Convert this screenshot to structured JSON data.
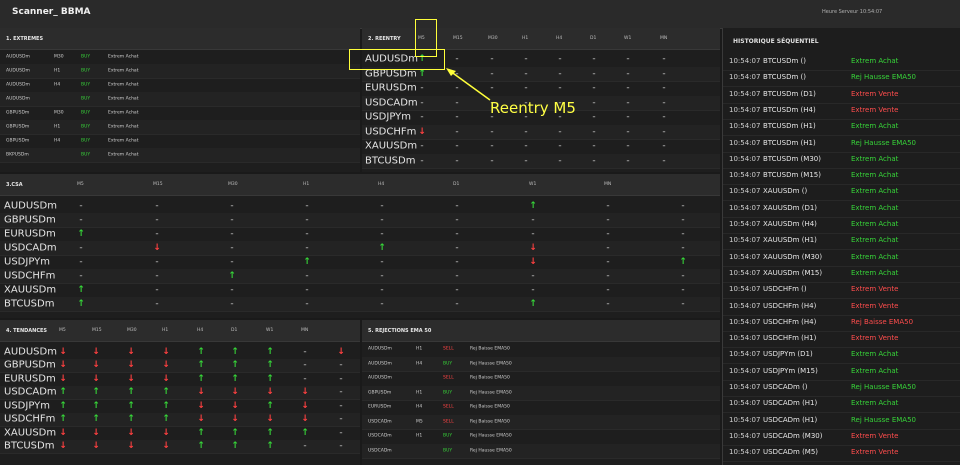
{
  "title": "Scanner_ BBMA",
  "hour": "Heure Serveur 10:54:07",
  "timeframes": [
    "M5",
    "M15",
    "M30",
    "H1",
    "H4",
    "D1",
    "W1",
    "MN"
  ],
  "extremes": {
    "title": "1. EXTREMES",
    "rows": [
      {
        "symbol": "AUDUSDm",
        "tf": "M30",
        "dir": "BUY",
        "label": "Extrem Achat"
      },
      {
        "symbol": "AUDUSDm",
        "tf": "H1",
        "dir": "BUY",
        "label": "Extrem Achat"
      },
      {
        "symbol": "AUDUSDm",
        "tf": "H4",
        "dir": "BUY",
        "label": "Extrem Achat"
      },
      {
        "symbol": "AUDUSDm",
        "tf": "",
        "dir": "BUY",
        "label": "Extrem Achat"
      },
      {
        "symbol": "GBPUSDm",
        "tf": "M30",
        "dir": "BUY",
        "label": "Extrem Achat"
      },
      {
        "symbol": "GBPUSDm",
        "tf": "H1",
        "dir": "BUY",
        "label": "Extrem Achat"
      },
      {
        "symbol": "GBPUSDm",
        "tf": "H4",
        "dir": "BUY",
        "label": "Extrem Achat"
      },
      {
        "symbol": "BKPUSDm",
        "tf": "",
        "dir": "BUY",
        "label": "Extrem Achat"
      }
    ]
  },
  "reentry": {
    "title": "2. REENTRY",
    "rows": [
      {
        "symbol": "AUDUSDm",
        "cells": [
          "up",
          "-",
          "-",
          "-",
          "-",
          "-",
          "-",
          "-"
        ]
      },
      {
        "symbol": "GBPUSDm",
        "cells": [
          "up",
          "-",
          "-",
          "-",
          "-",
          "-",
          "-",
          "-"
        ]
      },
      {
        "symbol": "EURUSDm",
        "cells": [
          "-",
          "-",
          "-",
          "-",
          "-",
          "-",
          "-",
          "-"
        ]
      },
      {
        "symbol": "USDCADm",
        "cells": [
          "-",
          "-",
          "-",
          "-",
          "-",
          "-",
          "-",
          "-"
        ]
      },
      {
        "symbol": "USDJPYm",
        "cells": [
          "-",
          "-",
          "-",
          "-",
          "-",
          "-",
          "-",
          "-"
        ]
      },
      {
        "symbol": "USDCHFm",
        "cells": [
          "down",
          "-",
          "-",
          "-",
          "-",
          "-",
          "-",
          "-"
        ]
      },
      {
        "symbol": "XAUUSDm",
        "cells": [
          "-",
          "-",
          "-",
          "-",
          "-",
          "-",
          "-",
          "-"
        ]
      },
      {
        "symbol": "BTCUSDm",
        "cells": [
          "-",
          "-",
          "-",
          "-",
          "-",
          "-",
          "-",
          "-"
        ]
      }
    ]
  },
  "csa": {
    "title": "3.CSA",
    "rows": [
      {
        "symbol": "AUDUSDm",
        "cells": [
          "-",
          "-",
          "-",
          "-",
          "-",
          "-",
          "up",
          "-",
          "-"
        ]
      },
      {
        "symbol": "GBPUSDm",
        "cells": [
          "-",
          "-",
          "-",
          "-",
          "-",
          "-",
          "-",
          "-",
          "-"
        ]
      },
      {
        "symbol": "EURUSDm",
        "cells": [
          "up",
          "-",
          "-",
          "-",
          "-",
          "-",
          "-",
          "-",
          "-"
        ]
      },
      {
        "symbol": "USDCADm",
        "cells": [
          "-",
          "down",
          "-",
          "-",
          "up",
          "-",
          "down",
          "-",
          "-"
        ]
      },
      {
        "symbol": "USDJPYm",
        "cells": [
          "-",
          "-",
          "-",
          "up",
          "-",
          "-",
          "down",
          "-",
          "up"
        ]
      },
      {
        "symbol": "USDCHFm",
        "cells": [
          "-",
          "-",
          "up",
          "-",
          "-",
          "-",
          "-",
          "-",
          "-"
        ]
      },
      {
        "symbol": "XAUUSDm",
        "cells": [
          "up",
          "-",
          "-",
          "-",
          "-",
          "-",
          "-",
          "-",
          "-"
        ]
      },
      {
        "symbol": "BTCUSDm",
        "cells": [
          "up",
          "-",
          "-",
          "-",
          "-",
          "-",
          "up",
          "-",
          "-"
        ]
      }
    ]
  },
  "tendances": {
    "title": "4. TENDANCES",
    "rows": [
      {
        "symbol": "AUDUSDm",
        "cells": [
          "down",
          "down",
          "down",
          "down",
          "up",
          "up",
          "up",
          "-",
          "down"
        ]
      },
      {
        "symbol": "GBPUSDm",
        "cells": [
          "down",
          "down",
          "down",
          "down",
          "up",
          "up",
          "up",
          "-",
          "-"
        ]
      },
      {
        "symbol": "EURUSDm",
        "cells": [
          "down",
          "down",
          "down",
          "down",
          "up",
          "up",
          "up",
          "-",
          "-"
        ]
      },
      {
        "symbol": "USDCADm",
        "cells": [
          "up",
          "up",
          "up",
          "up",
          "down",
          "down",
          "down",
          "down",
          "-"
        ]
      },
      {
        "symbol": "USDJPYm",
        "cells": [
          "up",
          "up",
          "up",
          "up",
          "down",
          "down",
          "up",
          "down",
          "-"
        ]
      },
      {
        "symbol": "USDCHFm",
        "cells": [
          "up",
          "up",
          "up",
          "up",
          "down",
          "down",
          "down",
          "down",
          "-"
        ]
      },
      {
        "symbol": "XAUUSDm",
        "cells": [
          "down",
          "down",
          "down",
          "down",
          "up",
          "up",
          "up",
          "up",
          "-"
        ]
      },
      {
        "symbol": "BTCUSDm",
        "cells": [
          "down",
          "down",
          "down",
          "down",
          "up",
          "up",
          "up",
          "-",
          "-"
        ]
      }
    ]
  },
  "rejections": {
    "title": "5. REJECTIONS EMA 50",
    "rows": [
      {
        "symbol": "AUDUSDm",
        "tf": "H1",
        "dir": "SELL",
        "label": "Rej Baisse EMA50"
      },
      {
        "symbol": "AUDUSDm",
        "tf": "H4",
        "dir": "BUY",
        "label": "Rej Hausse EMA50"
      },
      {
        "symbol": "AUDUSDm",
        "tf": "",
        "dir": "SELL",
        "label": "Rej Baisse EMA50"
      },
      {
        "symbol": "GBPUSDm",
        "tf": "H1",
        "dir": "BUY",
        "label": "Rej Hausse EMA50"
      },
      {
        "symbol": "EURUSDm",
        "tf": "H4",
        "dir": "SELL",
        "label": "Rej Baisse EMA50"
      },
      {
        "symbol": "USDCADm",
        "tf": "M5",
        "dir": "SELL",
        "label": "Rej Baisse EMA50"
      },
      {
        "symbol": "USDCADm",
        "tf": "H1",
        "dir": "BUY",
        "label": "Rej Hausse EMA50"
      },
      {
        "symbol": "USDCADm",
        "tf": "",
        "dir": "BUY",
        "label": "Rej Hausse EMA50"
      }
    ]
  },
  "history": {
    "title": "HISTORIQUE SÉQUENTIEL",
    "rows": [
      {
        "time": "10:54:07",
        "symbol": "BTCUSDm ()",
        "signal": "Extrem Achat",
        "color": "g"
      },
      {
        "time": "10:54:07",
        "symbol": "BTCUSDm ()",
        "signal": "Rej Hausse EMA50",
        "color": "g"
      },
      {
        "time": "10:54:07",
        "symbol": "BTCUSDm (D1)",
        "signal": "Extrem Vente",
        "color": "r"
      },
      {
        "time": "10:54:07",
        "symbol": "BTCUSDm (H4)",
        "signal": "Extrem Vente",
        "color": "r"
      },
      {
        "time": "10:54:07",
        "symbol": "BTCUSDm (H1)",
        "signal": "Extrem Achat",
        "color": "g"
      },
      {
        "time": "10:54:07",
        "symbol": "BTCUSDm (H1)",
        "signal": "Rej Hausse EMA50",
        "color": "g"
      },
      {
        "time": "10:54:07",
        "symbol": "BTCUSDm (M30)",
        "signal": "Extrem Achat",
        "color": "g"
      },
      {
        "time": "10:54:07",
        "symbol": "BTCUSDm (M15)",
        "signal": "Extrem Achat",
        "color": "g"
      },
      {
        "time": "10:54:07",
        "symbol": "XAUUSDm ()",
        "signal": "Extrem Achat",
        "color": "g"
      },
      {
        "time": "10:54:07",
        "symbol": "XAUUSDm (D1)",
        "signal": "Extrem Achat",
        "color": "g"
      },
      {
        "time": "10:54:07",
        "symbol": "XAUUSDm (H4)",
        "signal": "Extrem Achat",
        "color": "g"
      },
      {
        "time": "10:54:07",
        "symbol": "XAUUSDm (H1)",
        "signal": "Extrem Achat",
        "color": "g"
      },
      {
        "time": "10:54:07",
        "symbol": "XAUUSDm (M30)",
        "signal": "Extrem Achat",
        "color": "g"
      },
      {
        "time": "10:54:07",
        "symbol": "XAUUSDm (M15)",
        "signal": "Extrem Achat",
        "color": "g"
      },
      {
        "time": "10:54:07",
        "symbol": "USDCHFm ()",
        "signal": "Extrem Vente",
        "color": "r"
      },
      {
        "time": "10:54:07",
        "symbol": "USDCHFm (H4)",
        "signal": "Extrem Vente",
        "color": "r"
      },
      {
        "time": "10:54:07",
        "symbol": "USDCHFm (H4)",
        "signal": "Rej Baisse EMA50",
        "color": "r"
      },
      {
        "time": "10:54:07",
        "symbol": "USDCHFm (H1)",
        "signal": "Extrem Vente",
        "color": "r"
      },
      {
        "time": "10:54:07",
        "symbol": "USDJPYm (D1)",
        "signal": "Extrem Achat",
        "color": "g"
      },
      {
        "time": "10:54:07",
        "symbol": "USDJPYm (M15)",
        "signal": "Extrem Achat",
        "color": "g"
      },
      {
        "time": "10:54:07",
        "symbol": "USDCADm ()",
        "signal": "Rej Hausse EMA50",
        "color": "g"
      },
      {
        "time": "10:54:07",
        "symbol": "USDCADm (H1)",
        "signal": "Extrem Achat",
        "color": "g"
      },
      {
        "time": "10:54:07",
        "symbol": "USDCADm (H1)",
        "signal": "Rej Hausse EMA50",
        "color": "g"
      },
      {
        "time": "10:54:07",
        "symbol": "USDCADm (M30)",
        "signal": "Extrem Vente",
        "color": "r"
      },
      {
        "time": "10:54:07",
        "symbol": "USDCADm (M5)",
        "signal": "Extrem Vente",
        "color": "r"
      }
    ]
  },
  "annotation": "Reentry M5",
  "colors": {
    "up": "#37d439",
    "down": "#ff4040",
    "annotation": "#ffff3a",
    "background": "#1a1a1a"
  }
}
